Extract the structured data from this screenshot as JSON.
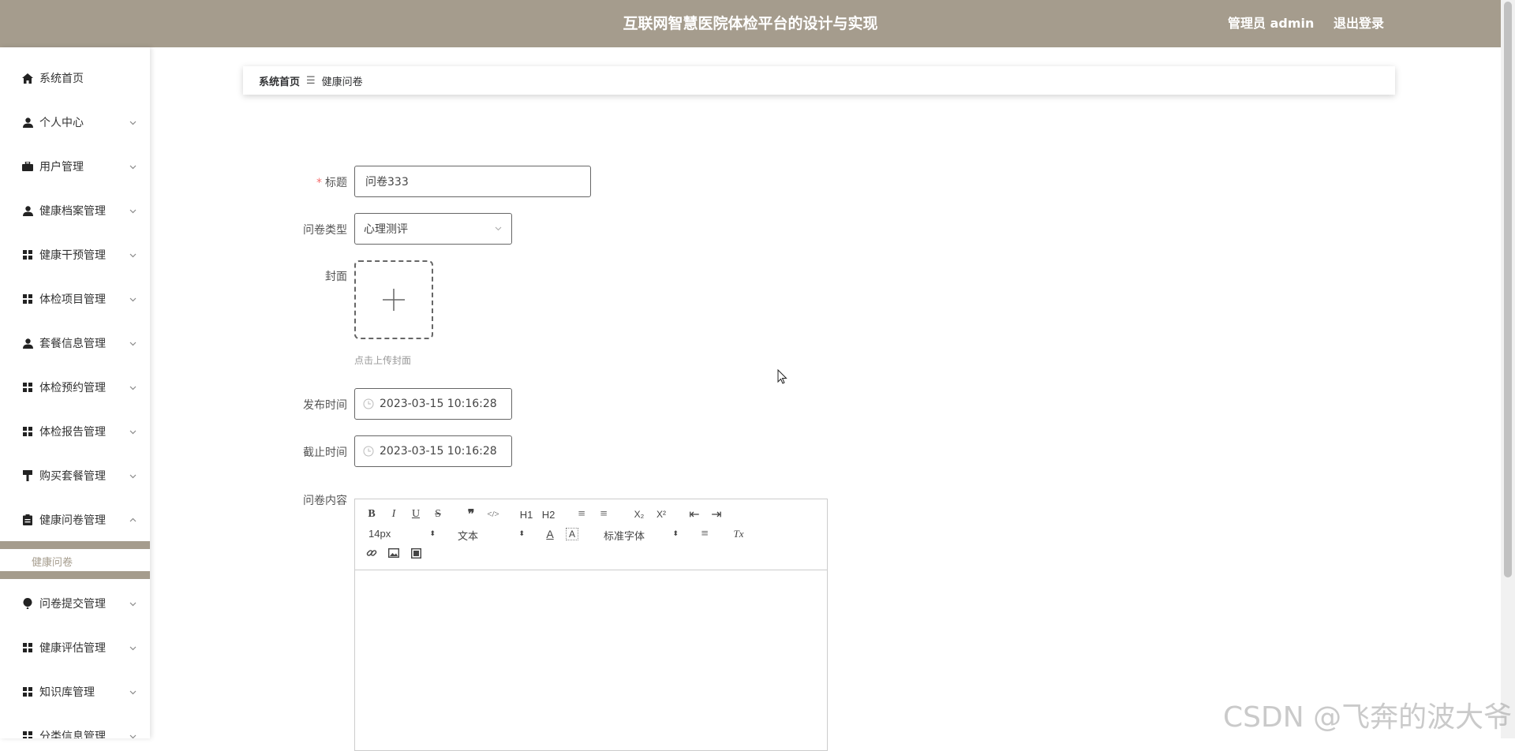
{
  "header": {
    "title": "互联网智慧医院体检平台的设计与实现",
    "user": "管理员 admin",
    "logout": "退出登录",
    "bg_color": "#a59c8d"
  },
  "sidebar": {
    "items": [
      {
        "label": "系统首页",
        "icon": "home-icon"
      },
      {
        "label": "个人中心",
        "icon": "user-icon"
      },
      {
        "label": "用户管理",
        "icon": "briefcase-icon"
      },
      {
        "label": "健康档案管理",
        "icon": "user-icon"
      },
      {
        "label": "健康干预管理",
        "icon": "grid-icon"
      },
      {
        "label": "体检项目管理",
        "icon": "grid-icon"
      },
      {
        "label": "套餐信息管理",
        "icon": "user-icon"
      },
      {
        "label": "体检预约管理",
        "icon": "grid-icon"
      },
      {
        "label": "体检报告管理",
        "icon": "grid-icon"
      },
      {
        "label": "购买套餐管理",
        "icon": "brush-icon"
      },
      {
        "label": "健康问卷管理",
        "icon": "clipboard-icon"
      },
      {
        "label": "问卷提交管理",
        "icon": "balloon-icon"
      },
      {
        "label": "健康评估管理",
        "icon": "grid-icon"
      },
      {
        "label": "知识库管理",
        "icon": "grid-icon"
      },
      {
        "label": "分类信息管理",
        "icon": "grid-icon"
      }
    ],
    "sub_item": "健康问卷",
    "accent_color": "#a59c8d"
  },
  "breadcrumb": {
    "home": "系统首页",
    "separator": "☰",
    "current": "健康问卷"
  },
  "form": {
    "title_label": "标题",
    "title_value": "问卷333",
    "type_label": "问卷类型",
    "type_value": "心理测评",
    "cover_label": "封面",
    "cover_tip": "点击上传封面",
    "publish_label": "发布时间",
    "publish_value": "2023-03-15 10:16:28",
    "deadline_label": "截止时间",
    "deadline_value": "2023-03-15 10:16:28",
    "content_label": "问卷内容",
    "required_mark": "*"
  },
  "editor": {
    "bold": "B",
    "italic": "I",
    "underline": "U",
    "strike": "S",
    "quote": "❞",
    "code": "</>",
    "h1": "H1",
    "h2": "H2",
    "ordered_list": "≡",
    "bullet_list": "≡",
    "subscript": "X₂",
    "superscript": "X²",
    "outdent": "⇤",
    "indent": "⇥",
    "size": "14px",
    "text_type": "文本",
    "color": "A",
    "background": "A",
    "font": "标准字体",
    "align": "≡",
    "clean": "Tx"
  },
  "watermark": "CSDN @飞奔的波大爷"
}
